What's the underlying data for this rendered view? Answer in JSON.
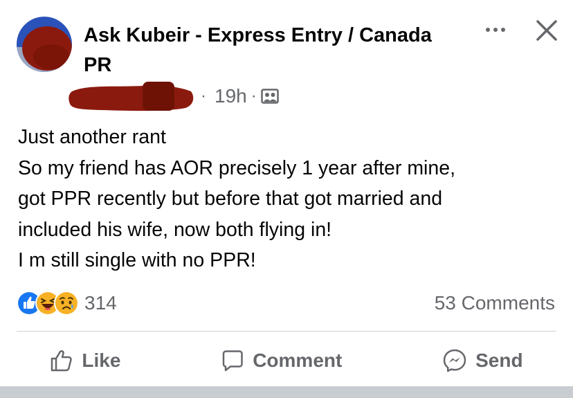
{
  "post": {
    "group_name": "Ask Kubeir - Express Entry / Canada PR",
    "time": "19h",
    "privacy_icon": "group-members-icon",
    "body_lines": [
      "Just another rant",
      "So my friend has AOR precisely 1 year after mine,",
      "got PPR recently but before that got married and",
      "included his wife, now both flying in!",
      "I m still single with no PPR!"
    ]
  },
  "reactions": {
    "icons": [
      "like-reaction-icon",
      "haha-reaction-icon",
      "sad-reaction-icon"
    ],
    "count": "314"
  },
  "comments": {
    "count_label": "53 Comments"
  },
  "actions": {
    "like_label": "Like",
    "comment_label": "Comment",
    "send_label": "Send"
  },
  "colors": {
    "text": "#050505",
    "secondary": "#65676b",
    "like_blue": "#1877f2",
    "reaction_yellow": "#f7b125",
    "redaction": "#8b1a0e"
  }
}
